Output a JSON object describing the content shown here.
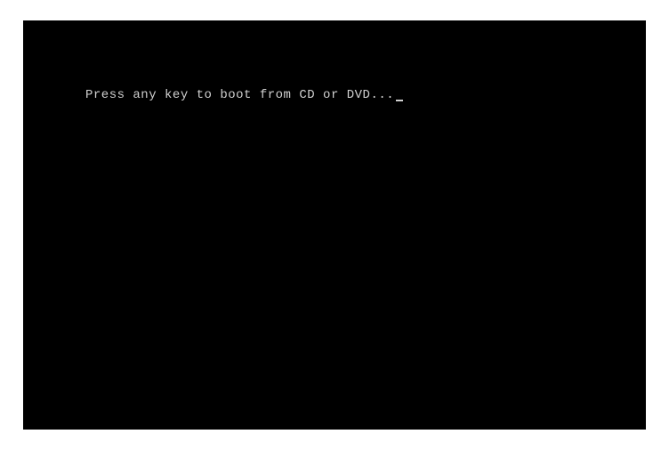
{
  "boot": {
    "prompt": "Press any key to boot from CD or DVD..."
  }
}
